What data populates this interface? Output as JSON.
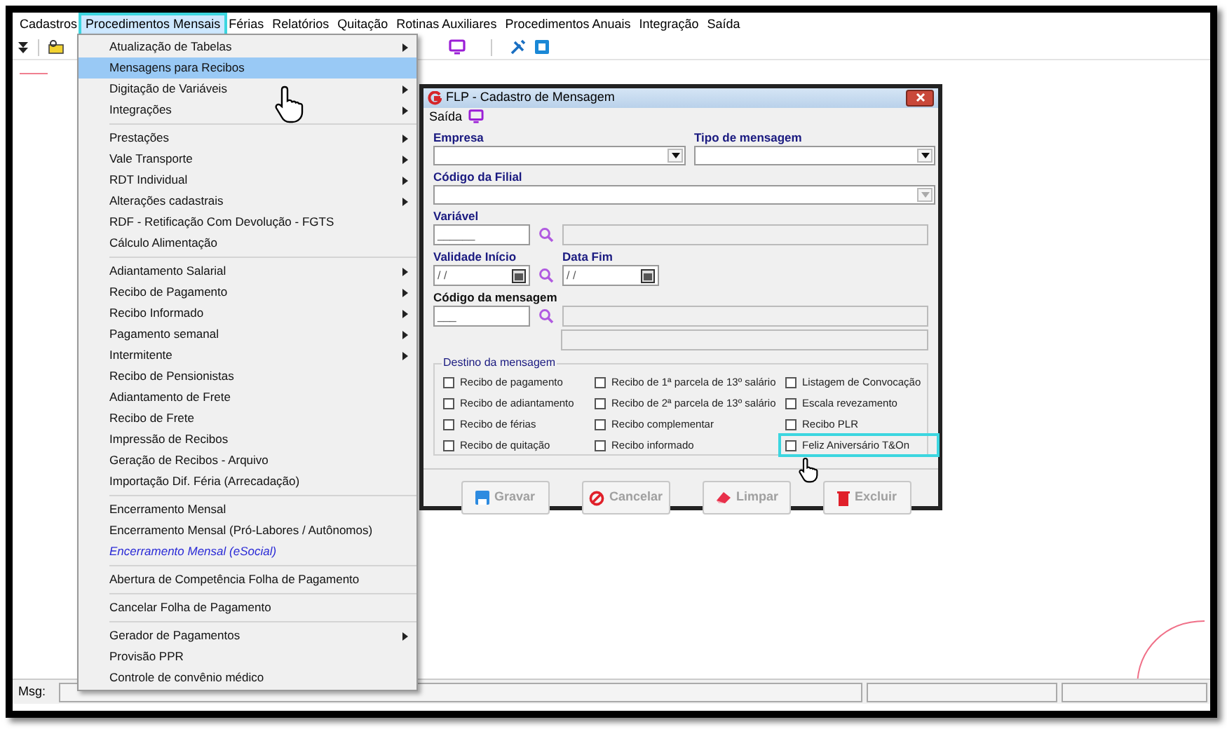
{
  "menubar": [
    {
      "label": "Cadastros",
      "selected": false
    },
    {
      "label": "Procedimentos Mensais",
      "selected": true
    },
    {
      "label": "Férias",
      "selected": false
    },
    {
      "label": "Relatórios",
      "selected": false
    },
    {
      "label": "Quitação",
      "selected": false
    },
    {
      "label": "Rotinas Auxiliares",
      "selected": false
    },
    {
      "label": "Procedimentos Anuais",
      "selected": false
    },
    {
      "label": "Integração",
      "selected": false
    },
    {
      "label": "Saída",
      "selected": false
    }
  ],
  "menu": {
    "groups": [
      [
        {
          "label": "Atualização de Tabelas",
          "submenu": true,
          "selected": false,
          "kind": "plain"
        },
        {
          "label": "Mensagens para Recibos",
          "submenu": false,
          "selected": true,
          "kind": "plain"
        },
        {
          "label": "Digitação de Variáveis",
          "submenu": true,
          "selected": false,
          "kind": "plain"
        },
        {
          "label": "Integrações",
          "submenu": true,
          "selected": false,
          "kind": "plain"
        }
      ],
      [
        {
          "label": "Prestações",
          "submenu": true,
          "selected": false,
          "kind": "plain"
        },
        {
          "label": "Vale Transporte",
          "submenu": true,
          "selected": false,
          "kind": "plain"
        },
        {
          "label": "RDT Individual",
          "submenu": true,
          "selected": false,
          "kind": "plain"
        },
        {
          "label": "Alterações cadastrais",
          "submenu": true,
          "selected": false,
          "kind": "plain"
        },
        {
          "label": "RDF - Retificação Com Devolução - FGTS",
          "submenu": false,
          "selected": false,
          "kind": "plain"
        },
        {
          "label": "Cálculo Alimentação",
          "submenu": false,
          "selected": false,
          "kind": "plain"
        }
      ],
      [
        {
          "label": "Adiantamento Salarial",
          "submenu": true,
          "selected": false,
          "kind": "plain"
        },
        {
          "label": "Recibo de Pagamento",
          "submenu": true,
          "selected": false,
          "kind": "plain"
        },
        {
          "label": "Recibo Informado",
          "submenu": true,
          "selected": false,
          "kind": "plain"
        },
        {
          "label": "Pagamento semanal",
          "submenu": true,
          "selected": false,
          "kind": "plain"
        },
        {
          "label": "Intermitente",
          "submenu": true,
          "selected": false,
          "kind": "plain"
        },
        {
          "label": "Recibo de Pensionistas",
          "submenu": false,
          "selected": false,
          "kind": "plain"
        },
        {
          "label": "Adiantamento de Frete",
          "submenu": false,
          "selected": false,
          "kind": "plain"
        },
        {
          "label": "Recibo de Frete",
          "submenu": false,
          "selected": false,
          "kind": "plain"
        },
        {
          "label": "Impressão de Recibos",
          "submenu": false,
          "selected": false,
          "kind": "plain"
        },
        {
          "label": "Geração de Recibos - Arquivo",
          "submenu": false,
          "selected": false,
          "kind": "plain"
        },
        {
          "label": "Importação Dif. Féria (Arrecadação)",
          "submenu": false,
          "selected": false,
          "kind": "plain"
        }
      ],
      [
        {
          "label": "Encerramento Mensal",
          "submenu": false,
          "selected": false,
          "kind": "plain"
        },
        {
          "label": "Encerramento Mensal (Pró-Labores / Autônomos)",
          "submenu": false,
          "selected": false,
          "kind": "plain"
        },
        {
          "label": "Encerramento Mensal (eSocial)",
          "submenu": false,
          "selected": false,
          "kind": "italic"
        }
      ],
      [
        {
          "label": "Abertura de Competência Folha de Pagamento",
          "submenu": false,
          "selected": false,
          "kind": "plain"
        }
      ],
      [
        {
          "label": "Cancelar Folha de Pagamento",
          "submenu": false,
          "selected": false,
          "kind": "plain"
        }
      ],
      [
        {
          "label": "Gerador de Pagamentos",
          "submenu": true,
          "selected": false,
          "kind": "plain"
        },
        {
          "label": "Provisão PPR",
          "submenu": false,
          "selected": false,
          "kind": "plain"
        },
        {
          "label": "Controle de convênio médico",
          "submenu": false,
          "selected": false,
          "kind": "plain"
        }
      ]
    ]
  },
  "dialog": {
    "title": "FLP - Cadastro de Mensagem",
    "menu": "Saída",
    "empresa": {
      "label": "Empresa"
    },
    "tipo": {
      "label": "Tipo de mensagem"
    },
    "filial": {
      "label": "Código da Filial"
    },
    "variavel": {
      "label": "Variável",
      "value": "______"
    },
    "inicio": {
      "label": "Validade Início",
      "value": "/ /"
    },
    "fim": {
      "label": "Data Fim",
      "value": "/ /"
    },
    "codigo": {
      "label": "Código da mensagem",
      "value": "___"
    },
    "group": {
      "title": "Destino da mensagem",
      "checkboxes": [
        {
          "label": "Recibo de pagamento",
          "checked": false,
          "highlighted": false
        },
        {
          "label": "Recibo de 1ª parcela de 13º salário",
          "checked": false,
          "highlighted": false
        },
        {
          "label": "Listagem de Convocação",
          "checked": false,
          "highlighted": false
        },
        {
          "label": "Recibo de adiantamento",
          "checked": false,
          "highlighted": false
        },
        {
          "label": "Recibo de 2ª parcela de 13º salário",
          "checked": false,
          "highlighted": false
        },
        {
          "label": "Escala revezamento",
          "checked": false,
          "highlighted": false
        },
        {
          "label": "Recibo de férias",
          "checked": false,
          "highlighted": false
        },
        {
          "label": "Recibo complementar",
          "checked": false,
          "highlighted": false
        },
        {
          "label": "Recibo PLR",
          "checked": false,
          "highlighted": false
        },
        {
          "label": "Recibo de quitação",
          "checked": false,
          "highlighted": false
        },
        {
          "label": "Recibo informado",
          "checked": false,
          "highlighted": false
        },
        {
          "label": "Feliz Aniversário T&On",
          "checked": false,
          "highlighted": true
        }
      ]
    },
    "buttons": [
      {
        "label": "Gravar",
        "kind": "save",
        "disabled": true
      },
      {
        "label": "Cancelar",
        "kind": "cancel",
        "disabled": true
      },
      {
        "label": "Limpar",
        "kind": "clear",
        "disabled": true
      },
      {
        "label": "Excluir",
        "kind": "delete",
        "disabled": true
      }
    ]
  },
  "status_bar": {
    "label": "Msg:"
  }
}
